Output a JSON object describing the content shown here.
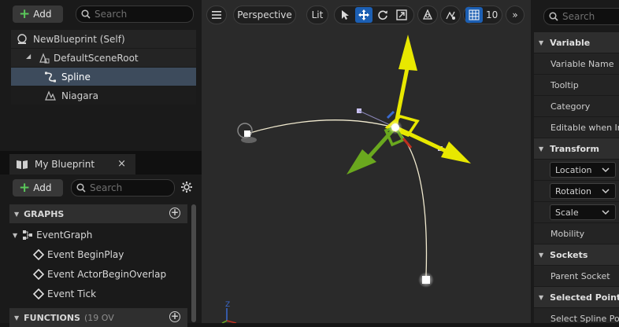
{
  "components": {
    "add_label": "Add",
    "search_placeholder": "Search",
    "tree": [
      {
        "label": "NewBlueprint (Self)",
        "icon": "blueprint-icon"
      },
      {
        "label": "DefaultSceneRoot",
        "icon": "scene-root-icon"
      },
      {
        "label": "Spline",
        "icon": "spline-icon"
      },
      {
        "label": "Niagara",
        "icon": "niagara-icon"
      }
    ]
  },
  "my_blueprint": {
    "tab_label": "My Blueprint",
    "close_glyph": "×",
    "add_label": "Add",
    "search_placeholder": "Search",
    "graphs_header": "GRAPHS",
    "event_graph": "EventGraph",
    "events": [
      "Event BeginPlay",
      "Event ActorBeginOverlap",
      "Event Tick"
    ],
    "functions_header": "FUNCTIONS",
    "functions_count": "(19 OV"
  },
  "viewport": {
    "perspective_label": "Perspective",
    "lit_label": "Lit",
    "grid_snap_value": "10",
    "colors": {
      "x_axis": "#c03020",
      "y_axis": "#6aa81e",
      "z_axis": "#e8e800",
      "accent": "#1c5fb3"
    }
  },
  "details": {
    "search_placeholder": "Search",
    "sections": {
      "variable": "Variable",
      "transform": "Transform",
      "sockets": "Sockets",
      "selected_points": "Selected Points"
    },
    "rows": {
      "variable_name": "Variable Name",
      "tooltip": "Tooltip",
      "category": "Category",
      "editable": "Editable when Inh",
      "location": "Location",
      "rotation": "Rotation",
      "scale": "Scale",
      "mobility": "Mobility",
      "parent_socket": "Parent Socket",
      "select_spline_point": "Select Spline Poi"
    }
  }
}
